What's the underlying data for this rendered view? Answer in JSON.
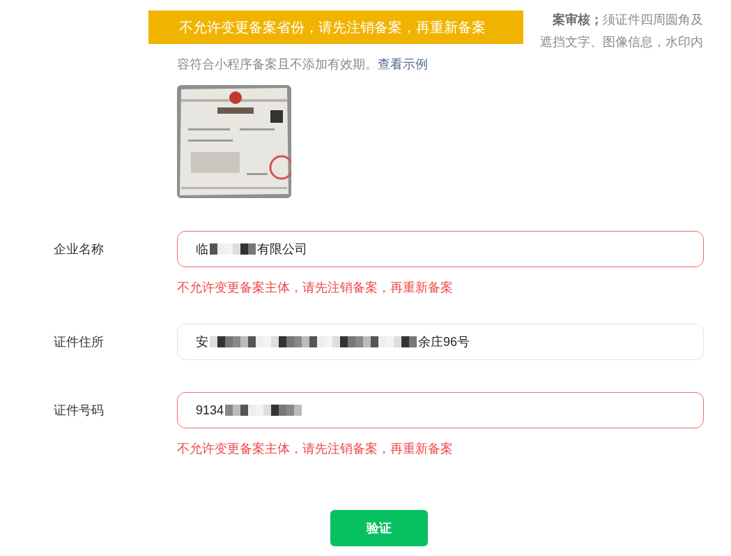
{
  "intro": {
    "lines": [
      "**案审核；**须证件四周圆角及",
      "遮挡文字、图像信息，水印内",
      "容符合小程序备案且不添加有效期。"
    ],
    "link": "查看示例"
  },
  "toast": {
    "text": "不允许变更备案省份，请先注销备案，再重新备案"
  },
  "fields": [
    {
      "label": "企业名称",
      "value_parts": [
        "临",
        "有限公司"
      ],
      "error": "不允许变更备案主体，请先注销备案，再重新备案"
    },
    {
      "label": "证件住所",
      "value_parts": [
        "安",
        "余庄96号"
      ]
    },
    {
      "label": "证件号码",
      "value_parts": [
        "9134"
      ],
      "error": "不允许变更备案主体，请先注销备案，再重新备案"
    }
  ],
  "submit_button": {
    "label": "验证"
  }
}
